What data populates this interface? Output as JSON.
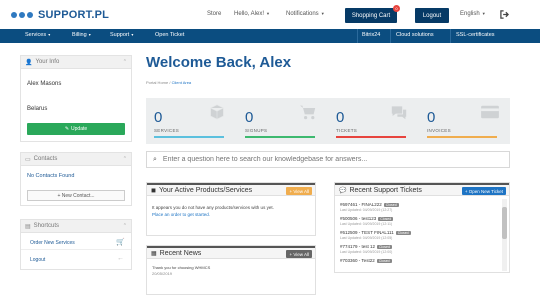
{
  "brand": {
    "name": "SUPPORT.PL"
  },
  "header": {
    "store": "Store",
    "greeting": "Hello, Alex!",
    "notifications": "Notifications",
    "shopping_cart": "Shopping Cart",
    "cart_count": "0",
    "logout": "Logout",
    "language": "English"
  },
  "nav": {
    "left": [
      "Services",
      "Billing",
      "Support",
      "Open Ticket"
    ],
    "right": [
      "Bitrix24",
      "Cloud solutions",
      "SSL-certificates"
    ]
  },
  "sidebar": {
    "your_info": {
      "title": "Your Info",
      "name": "Alex Masons",
      "country": "Belarus",
      "update": "Update"
    },
    "contacts": {
      "title": "Contacts",
      "empty": "No Contacts Found",
      "new_contact": "+ New Contact..."
    },
    "shortcuts": {
      "title": "Shortcuts",
      "items": [
        "Order New Services",
        "Logout"
      ]
    }
  },
  "main": {
    "welcome": "Welcome Back, Alex",
    "breadcrumb": {
      "home": "Portal Home",
      "current": "Client Area"
    },
    "stats": [
      {
        "value": "0",
        "label": "SERVICES",
        "color": "#5bc0de"
      },
      {
        "value": "0",
        "label": "SIGNUPS",
        "color": "#3db96f"
      },
      {
        "value": "0",
        "label": "TICKETS",
        "color": "#e7443e"
      },
      {
        "value": "0",
        "label": "INVOICES",
        "color": "#f0ad4e"
      }
    ],
    "search_placeholder": "Enter a question here to search our knowledgebase for answers...",
    "products": {
      "title": "Your Active Products/Services",
      "view_all": "+ View All",
      "text": "It appears you do not have any products/services with us yet.",
      "link": "Place an order to get started."
    },
    "news": {
      "title": "Recent News",
      "view_all": "+ View All",
      "text": "Thank you for choosing WHMCS",
      "date": "20/05/2019"
    },
    "tickets": {
      "title": "Recent Support Tickets",
      "open_new": "+ Open New Ticket",
      "items": [
        {
          "id": "#697461 - FINAL222",
          "status": "Closed",
          "updated": "Last Updated: 04/09/2019 (12:27)"
        },
        {
          "id": "#500506 - test123",
          "status": "Closed",
          "updated": "Last Updated: 04/09/2019 (12:11)"
        },
        {
          "id": "#612509 - TEST FINAL111",
          "status": "Closed",
          "updated": "Last Updated: 04/09/2019 (12:05)"
        },
        {
          "id": "#774179 - test 12",
          "status": "Closed",
          "updated": "Last Updated: 04/09/2019 (12:00)"
        },
        {
          "id": "#703360 - Test22",
          "status": "Closed",
          "updated": ""
        }
      ]
    }
  },
  "colors": {
    "brand": "#1e5a96",
    "nav": "#0b4d80",
    "button": "#063a66",
    "update": "#2aa85a",
    "orange": "#f0ad4e",
    "blue": "#1e74c4"
  }
}
